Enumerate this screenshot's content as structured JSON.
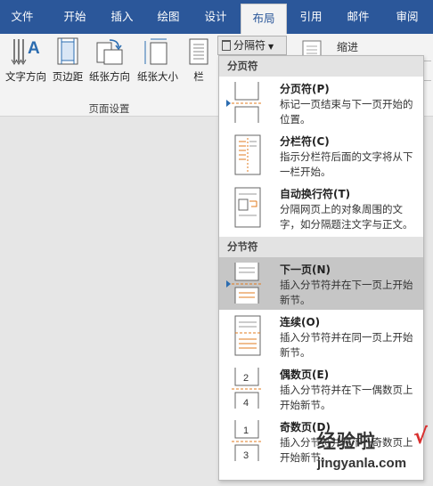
{
  "tabs": [
    {
      "label": "文件"
    },
    {
      "label": "开始"
    },
    {
      "label": "插入"
    },
    {
      "label": "绘图"
    },
    {
      "label": "设计"
    },
    {
      "label": "布局"
    },
    {
      "label": "引用"
    },
    {
      "label": "邮件"
    },
    {
      "label": "审阅"
    }
  ],
  "ribbon": {
    "text_direction": "文字方向",
    "margins": "页边距",
    "orientation": "纸张方向",
    "size": "纸张大小",
    "columns": "栏",
    "group_label": "页面设置",
    "breaks_button": "分隔符",
    "indent_label": "缩进"
  },
  "dropdown": {
    "page_breaks_header": "分页符",
    "section_breaks_header": "分节符",
    "items": [
      {
        "title": "分页符(P)",
        "desc": "标记一页结束与下一页开始的位置。",
        "icon": "page-break-icon"
      },
      {
        "title": "分栏符(C)",
        "desc": "指示分栏符后面的文字将从下一栏开始。",
        "icon": "column-break-icon"
      },
      {
        "title": "自动换行符(T)",
        "desc": "分隔网页上的对象周围的文字，如分隔题注文字与正文。",
        "icon": "text-wrapping-icon"
      },
      {
        "title": "下一页(N)",
        "desc": "插入分节符并在下一页上开始新节。",
        "icon": "next-page-icon"
      },
      {
        "title": "连续(O)",
        "desc": "插入分节符并在同一页上开始新节。",
        "icon": "continuous-icon"
      },
      {
        "title": "偶数页(E)",
        "desc": "插入分节符并在下一偶数页上开始新节。",
        "icon": "even-page-icon"
      },
      {
        "title": "奇数页(D)",
        "desc": "插入分节符并在下一奇数页上开始新节。",
        "icon": "odd-page-icon"
      }
    ]
  },
  "watermark": {
    "text": "经验啦",
    "check": "√",
    "url": "jingyanla.com"
  },
  "colors": {
    "ribbon_blue": "#2b579a",
    "highlight": "#c6c6c6",
    "accent_orange": "#e07b1f"
  }
}
